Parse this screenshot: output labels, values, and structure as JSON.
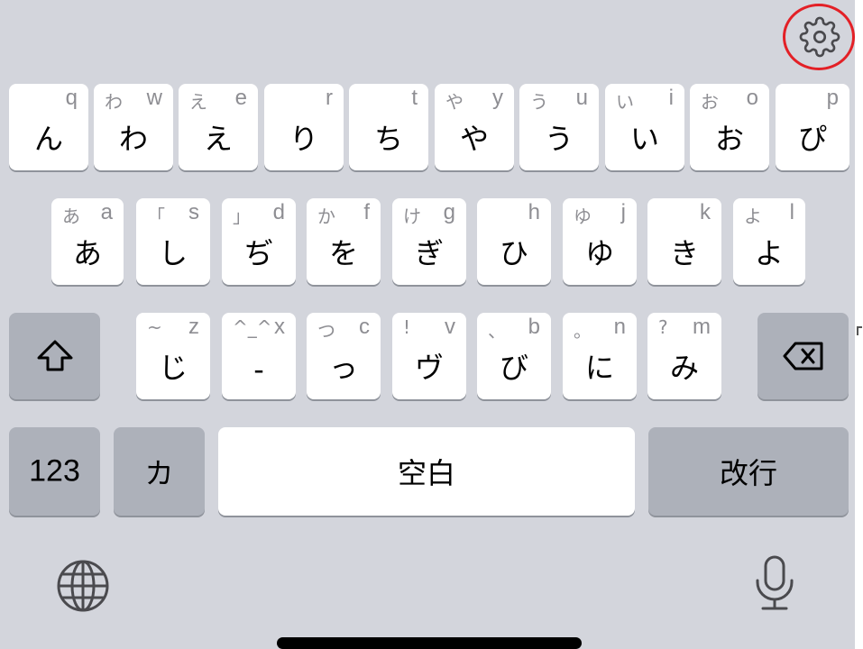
{
  "keyboard": {
    "row1": [
      {
        "hint": "",
        "latin": "q",
        "main": "ん"
      },
      {
        "hint": "わ",
        "latin": "w",
        "main": "わ"
      },
      {
        "hint": "え",
        "latin": "e",
        "main": "え"
      },
      {
        "hint": "",
        "latin": "r",
        "main": "り"
      },
      {
        "hint": "",
        "latin": "t",
        "main": "ち"
      },
      {
        "hint": "や",
        "latin": "y",
        "main": "や"
      },
      {
        "hint": "う",
        "latin": "u",
        "main": "う"
      },
      {
        "hint": "い",
        "latin": "i",
        "main": "い"
      },
      {
        "hint": "お",
        "latin": "o",
        "main": "お"
      },
      {
        "hint": "",
        "latin": "p",
        "main": "ぴ"
      }
    ],
    "row2": [
      {
        "hint": "あ",
        "latin": "a",
        "main": "あ"
      },
      {
        "hint": "「",
        "latin": "s",
        "main": "し"
      },
      {
        "hint": "」",
        "latin": "d",
        "main": "ぢ"
      },
      {
        "hint": "か",
        "latin": "f",
        "main": "を"
      },
      {
        "hint": "け",
        "latin": "g",
        "main": "ぎ"
      },
      {
        "hint": "",
        "latin": "h",
        "main": "ひ"
      },
      {
        "hint": "ゆ",
        "latin": "j",
        "main": "ゆ"
      },
      {
        "hint": "",
        "latin": "k",
        "main": "き"
      },
      {
        "hint": "よ",
        "latin": "l",
        "main": "よ"
      }
    ],
    "row3": [
      {
        "hint": "~",
        "latin": "z",
        "main": "じ"
      },
      {
        "hint": "^_^",
        "latin": "x",
        "main": "-"
      },
      {
        "hint": "つ",
        "latin": "c",
        "main": "っ"
      },
      {
        "hint": "!",
        "latin": "v",
        "main": "ヴ"
      },
      {
        "hint": "、",
        "latin": "b",
        "main": "び"
      },
      {
        "hint": "。",
        "latin": "n",
        "main": "に"
      },
      {
        "hint": "?",
        "latin": "m",
        "main": "み"
      }
    ],
    "bottom": {
      "numbers_label": "123",
      "kana_label": "カ",
      "space_label": "空白",
      "return_label": "改行"
    }
  },
  "icons": {
    "settings": "gear-icon",
    "shift": "shift-icon",
    "delete": "delete-icon",
    "globe": "globe-icon",
    "mic": "microphone-icon"
  },
  "colors": {
    "background": "#d3d5dc",
    "key": "#ffffff",
    "function_key": "#adb1ba",
    "highlight_circle": "#e32026"
  }
}
